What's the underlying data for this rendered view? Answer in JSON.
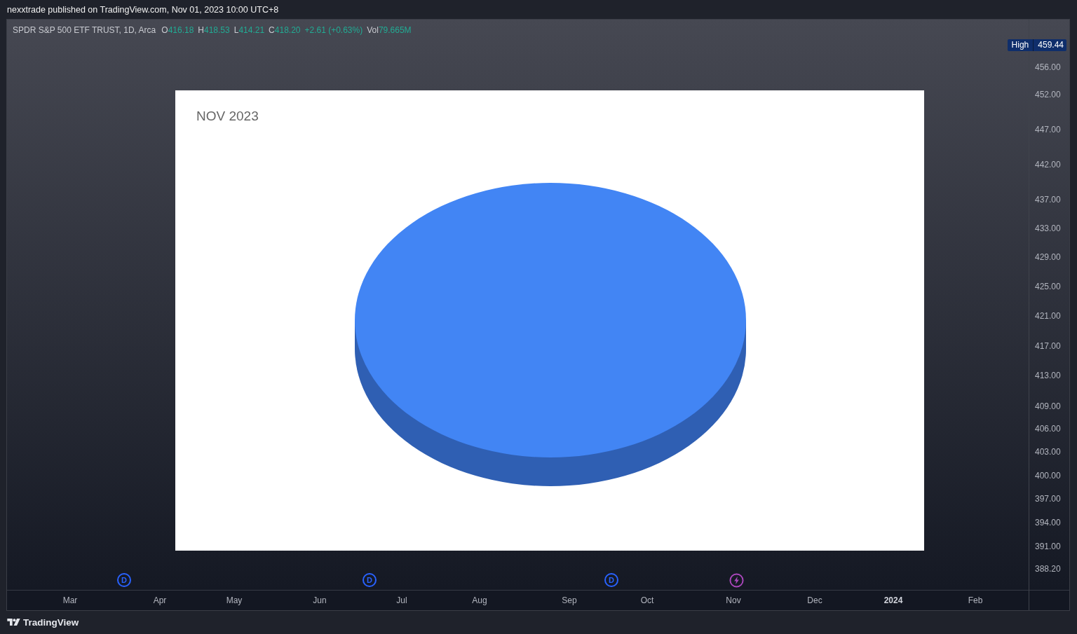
{
  "header": {
    "text": "nexxtrade published on TradingView.com, Nov 01, 2023 10:00 UTC+8"
  },
  "legend": {
    "symbol": "SPDR S&P 500 ETF TRUST, 1D, Arca",
    "values": [
      {
        "label": "O",
        "value": "416.18"
      },
      {
        "label": "H",
        "value": "418.53"
      },
      {
        "label": "L",
        "value": "414.21"
      },
      {
        "label": "C",
        "value": "418.20"
      },
      {
        "value": "+2.61 (+0.63%)"
      },
      {
        "label": "Vol",
        "value": "79.665M"
      }
    ]
  },
  "overlay": {
    "title": "NOV 2023"
  },
  "high_marker": {
    "label": "High",
    "value": "459.44"
  },
  "price_axis": [
    "456.00",
    "452.00",
    "447.00",
    "442.00",
    "437.00",
    "433.00",
    "429.00",
    "425.00",
    "421.00",
    "417.00",
    "413.00",
    "409.00",
    "406.00",
    "403.00",
    "400.00",
    "397.00",
    "394.00",
    "391.00",
    "388.20"
  ],
  "events": [
    {
      "kind": "dividend",
      "label": "D"
    },
    {
      "kind": "dividend",
      "label": "D"
    },
    {
      "kind": "dividend",
      "label": "D"
    },
    {
      "kind": "earnings"
    }
  ],
  "time_axis": [
    {
      "label": "Mar",
      "bold": false
    },
    {
      "label": "Apr",
      "bold": false
    },
    {
      "label": "May",
      "bold": false
    },
    {
      "label": "Jun",
      "bold": false
    },
    {
      "label": "Jul",
      "bold": false
    },
    {
      "label": "Aug",
      "bold": false
    },
    {
      "label": "Sep",
      "bold": false
    },
    {
      "label": "Oct",
      "bold": false
    },
    {
      "label": "Nov",
      "bold": false
    },
    {
      "label": "Dec",
      "bold": false
    },
    {
      "label": "2024",
      "bold": true
    },
    {
      "label": "Feb",
      "bold": false
    }
  ],
  "footer": {
    "brand": "TradingView"
  }
}
